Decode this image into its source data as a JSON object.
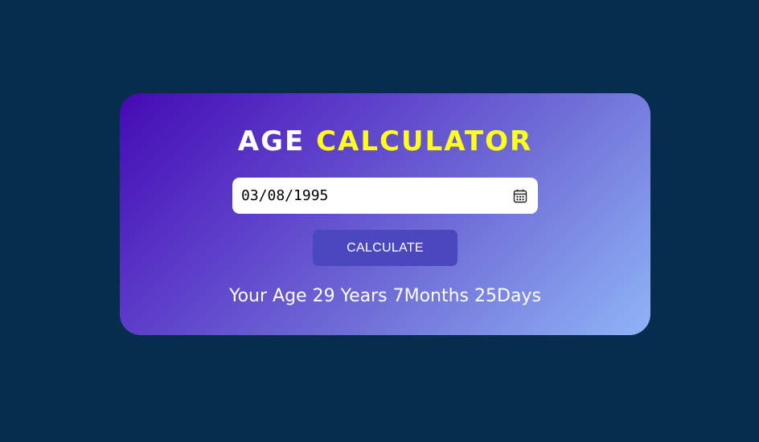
{
  "app": {
    "title_part1": "AGE",
    "title_part2": "CALCULATOR"
  },
  "form": {
    "date_value": "03/08/1995",
    "calendar_icon": "calendar-icon",
    "calculate_label": "CALCULATE"
  },
  "result": {
    "text": "Your Age 29 Years 7Months 25Days"
  },
  "colors": {
    "page_background": "#062d4e",
    "title_white": "#ffffff",
    "title_accent": "#ffff1a",
    "button_background": "#4b48be",
    "card_gradient_start": "#430ab3",
    "card_gradient_end": "#8fb4f6"
  }
}
